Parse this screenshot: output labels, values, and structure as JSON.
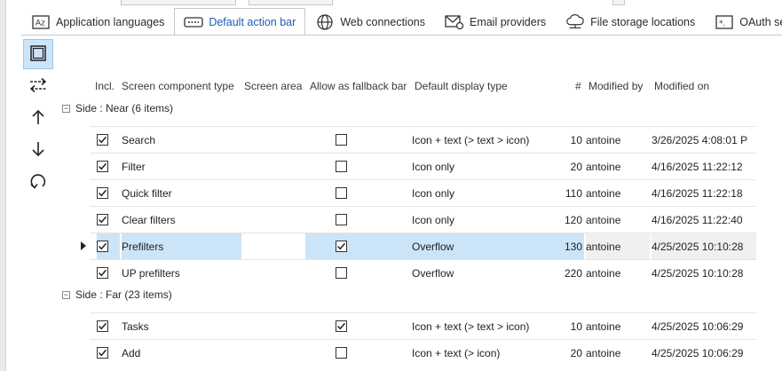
{
  "tabs": [
    {
      "label": "Application languages",
      "icon": "translate-icon",
      "active": false
    },
    {
      "label": "Default action bar",
      "icon": "keyboard-icon",
      "active": true
    },
    {
      "label": "Web connections",
      "icon": "globe-icon",
      "active": false
    },
    {
      "label": "Email providers",
      "icon": "email-settings-icon",
      "active": false
    },
    {
      "label": "File storage locations",
      "icon": "cloud-storage-icon",
      "active": false
    },
    {
      "label": "OAuth server",
      "icon": "oauth-icon",
      "active": false
    }
  ],
  "toolbar": {
    "icons": [
      "select-all-icon",
      "swap-icon",
      "move-up-icon",
      "move-down-icon",
      "refresh-icon"
    ]
  },
  "columns": {
    "incl": "Incl.",
    "type": "Screen component type",
    "area": "Screen area",
    "fallback": "Allow as fallback bar",
    "display": "Default display type",
    "num": "#",
    "modified_by": "Modified by",
    "modified_on": "Modified on"
  },
  "groups": [
    {
      "label": "Side : Near (6 items)",
      "rows": [
        {
          "incl": true,
          "type": "Search",
          "area": "",
          "fallback": false,
          "display": "Icon + text (> text > icon)",
          "num": "10",
          "by": "antoine",
          "on": "3/26/2025 4:08:01 P"
        },
        {
          "incl": true,
          "type": "Filter",
          "area": "",
          "fallback": false,
          "display": "Icon only",
          "num": "20",
          "by": "antoine",
          "on": "4/16/2025 11:22:12"
        },
        {
          "incl": true,
          "type": "Quick filter",
          "area": "",
          "fallback": false,
          "display": "Icon only",
          "num": "110",
          "by": "antoine",
          "on": "4/16/2025 11:22:18"
        },
        {
          "incl": true,
          "type": "Clear filters",
          "area": "",
          "fallback": false,
          "display": "Icon only",
          "num": "120",
          "by": "antoine",
          "on": "4/16/2025 11:22:40"
        },
        {
          "incl": true,
          "type": "Prefilters",
          "area": "",
          "fallback": true,
          "display": "Overflow",
          "num": "130",
          "by": "antoine",
          "on": "4/25/2025 10:10:28",
          "selected": true
        },
        {
          "incl": true,
          "type": "UP prefilters",
          "area": "",
          "fallback": false,
          "display": "Overflow",
          "num": "220",
          "by": "antoine",
          "on": "4/25/2025 10:10:28"
        }
      ]
    },
    {
      "label": "Side : Far (23 items)",
      "rows": [
        {
          "incl": true,
          "type": "Tasks",
          "area": "",
          "fallback": true,
          "display": "Icon + text (> text > icon)",
          "num": "10",
          "by": "antoine",
          "on": "4/25/2025 10:06:29"
        },
        {
          "incl": true,
          "type": "Add",
          "area": "",
          "fallback": false,
          "display": "Icon + text (> icon)",
          "num": "20",
          "by": "antoine",
          "on": "4/25/2025 10:06:29"
        }
      ]
    }
  ],
  "colors": {
    "accent": "#1a5fb4",
    "selection": "#cce4f7"
  }
}
